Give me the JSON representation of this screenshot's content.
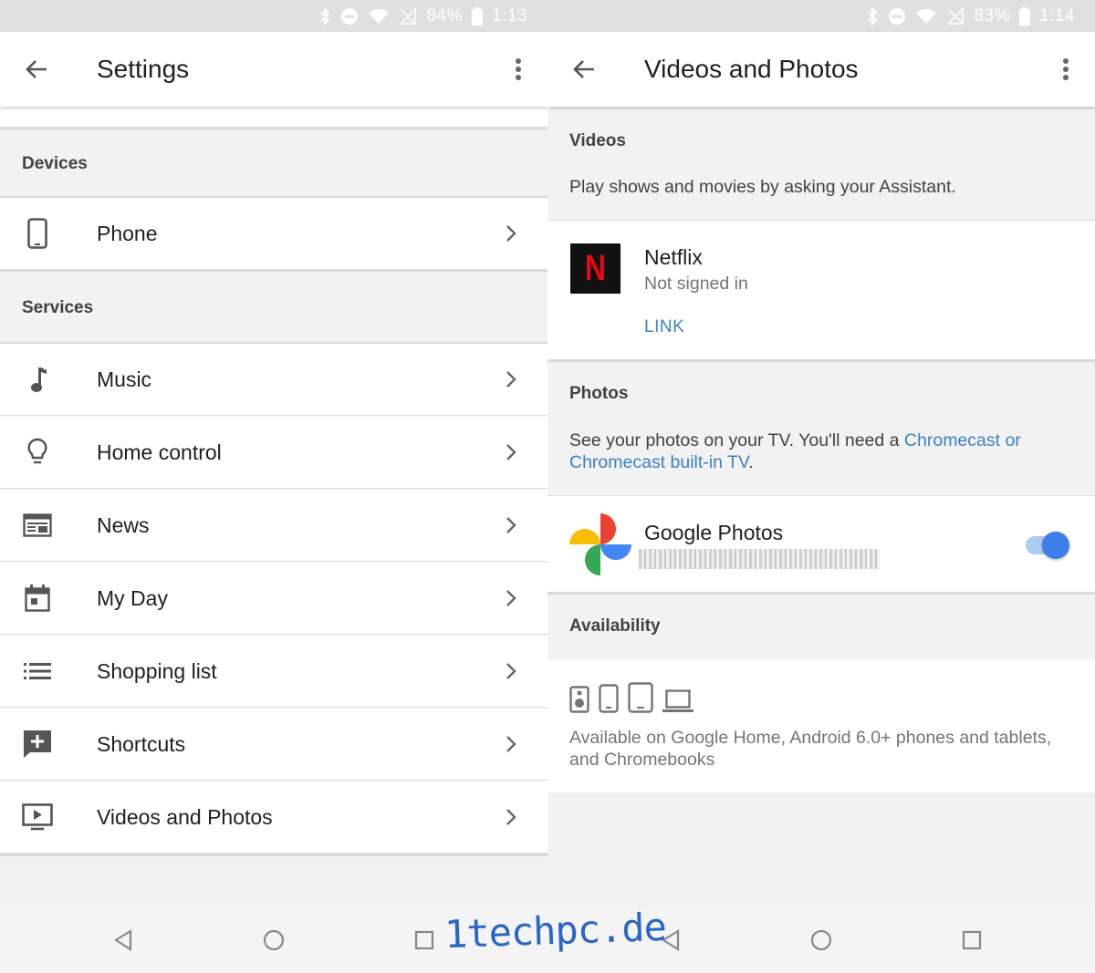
{
  "left": {
    "status": {
      "battery": "84%",
      "time": "1:13"
    },
    "app_bar": {
      "title": "Settings"
    },
    "sections": [
      {
        "header": "Devices",
        "items": [
          {
            "label": "Phone",
            "icon": "phone-icon"
          }
        ]
      },
      {
        "header": "Services",
        "items": [
          {
            "label": "Music",
            "icon": "music-note-icon"
          },
          {
            "label": "Home control",
            "icon": "lightbulb-icon"
          },
          {
            "label": "News",
            "icon": "newspaper-icon"
          },
          {
            "label": "My Day",
            "icon": "calendar-icon"
          },
          {
            "label": "Shopping list",
            "icon": "list-icon"
          },
          {
            "label": "Shortcuts",
            "icon": "add-comment-icon"
          },
          {
            "label": "Videos and Photos",
            "icon": "video-icon"
          }
        ]
      }
    ]
  },
  "right": {
    "status": {
      "battery": "83%",
      "time": "1:14"
    },
    "app_bar": {
      "title": "Videos and Photos"
    },
    "videos": {
      "header": "Videos",
      "description": "Play shows and movies by asking your Assistant.",
      "netflix": {
        "name": "Netflix",
        "status": "Not signed in",
        "link_label": "LINK",
        "logo_letter": "N"
      }
    },
    "photos": {
      "header": "Photos",
      "description_prefix": "See your photos on your TV. You'll need a ",
      "description_link_line1": "Chromecast or",
      "description_link_line2": "Chromecast built-in TV",
      "description_suffix": ".",
      "google_photos": {
        "name": "Google Photos",
        "toggle_on": true
      }
    },
    "availability": {
      "header": "Availability",
      "device_icons": [
        "speaker-icon",
        "phone-icon",
        "tablet-icon",
        "laptop-icon"
      ],
      "description_line1": "Available on Google Home, Android 6.0+ phones and tablets,",
      "description_line2": "and Chromebooks"
    }
  },
  "nav": {
    "buttons": [
      "back",
      "home",
      "recents"
    ]
  },
  "watermark": "1techpc.de",
  "colors": {
    "accent": "#3d7fe8",
    "link": "#3b82c4",
    "netflix_red": "#e50914"
  }
}
